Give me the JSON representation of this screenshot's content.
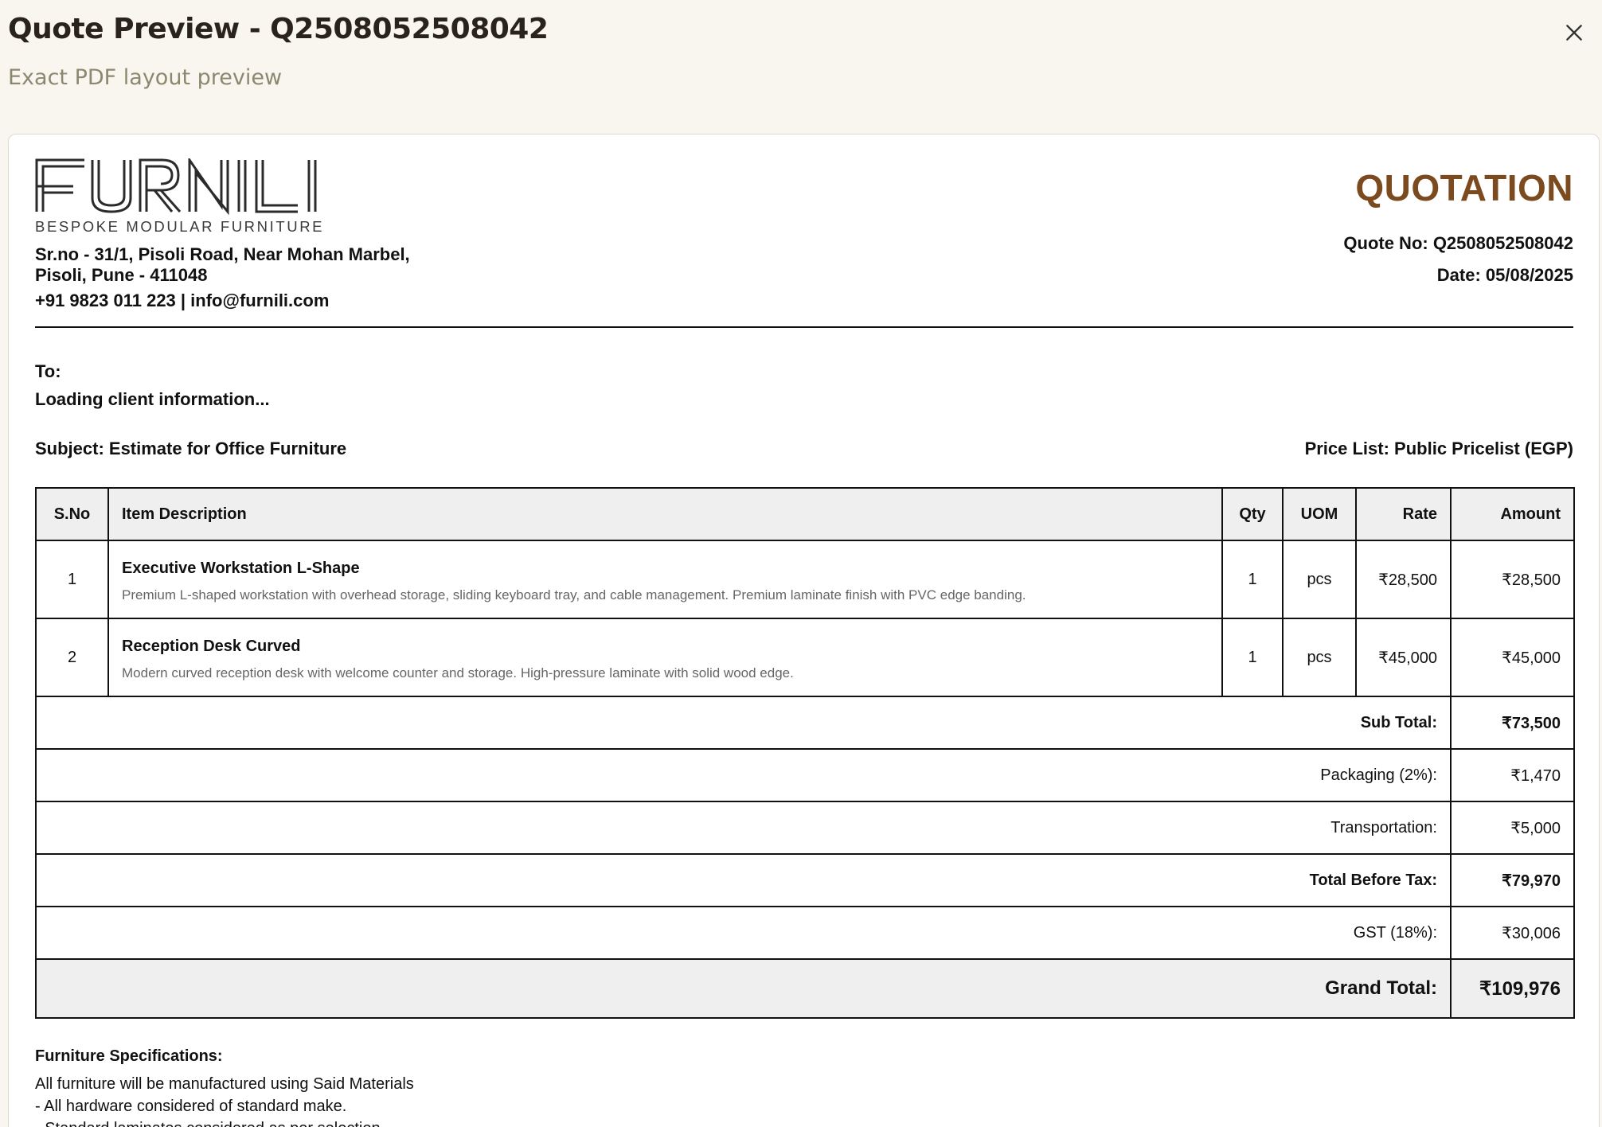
{
  "modal": {
    "title": "Quote Preview - Q2508052508042",
    "subtitle": "Exact PDF layout preview",
    "close_icon": "close-icon"
  },
  "company": {
    "logo_text": "FURNILI",
    "tagline": "BESPOKE MODULAR FURNITURE",
    "address_line1": "Sr.no - 31/1, Pisoli Road, Near Mohan Marbel,",
    "address_line2": "Pisoli, Pune - 411048",
    "contact": "+91 9823 011 223 | info@furnili.com"
  },
  "quote": {
    "doc_title": "QUOTATION",
    "quote_no": "Quote No: Q2508052508042",
    "date": "Date: 05/08/2025",
    "to_label": "To:",
    "client": "Loading client information...",
    "subject": "Subject: Estimate for Office Furniture",
    "price_list": "Price List: Public Pricelist (EGP)"
  },
  "table": {
    "headers": {
      "sno": "S.No",
      "description": "Item Description",
      "qty": "Qty",
      "uom": "UOM",
      "rate": "Rate",
      "amount": "Amount"
    },
    "rows": [
      {
        "sno": "1",
        "name": "Executive Workstation L-Shape",
        "note": "Premium L-shaped workstation with overhead storage, sliding keyboard tray, and cable management. Premium laminate finish with PVC edge banding.",
        "qty": "1",
        "uom": "pcs",
        "rate": "₹28,500",
        "amount": "₹28,500"
      },
      {
        "sno": "2",
        "name": "Reception Desk Curved",
        "note": "Modern curved reception desk with welcome counter and storage. High-pressure laminate with solid wood edge.",
        "qty": "1",
        "uom": "pcs",
        "rate": "₹45,000",
        "amount": "₹45,000"
      }
    ],
    "summary": {
      "subtotal_label": "Sub Total:",
      "subtotal": "₹73,500",
      "packaging_label": "Packaging (2%):",
      "packaging": "₹1,470",
      "transport_label": "Transportation:",
      "transport": "₹5,000",
      "before_tax_label": "Total Before Tax:",
      "before_tax": "₹79,970",
      "gst_label": "GST (18%):",
      "gst": "₹30,006",
      "grand_label": "Grand Total:",
      "grand": "₹109,976"
    }
  },
  "specs": {
    "title": "Furniture Specifications:",
    "line1": "All furniture will be manufactured using Said Materials",
    "line2": "- All hardware considered of standard make.",
    "line3": "- Standard laminates considered as per selection."
  },
  "colors": {
    "accent": "#7b4a1e",
    "background": "#f8f6ef",
    "table_header": "#efefef"
  }
}
